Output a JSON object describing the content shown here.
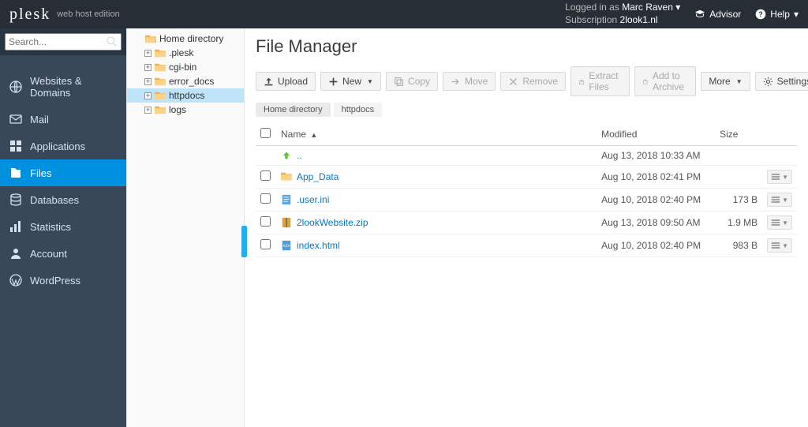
{
  "header": {
    "brand": "plesk",
    "brand_sub": "web host edition",
    "logged_in_label": "Logged in as",
    "user": "Marc Raven",
    "subscription_label": "Subscription",
    "subscription": "2look1.nl",
    "advisor": "Advisor",
    "help": "Help"
  },
  "search": {
    "placeholder": "Search..."
  },
  "nav": {
    "items": [
      {
        "label": "Websites & Domains"
      },
      {
        "label": "Mail"
      },
      {
        "label": "Applications"
      },
      {
        "label": "Files"
      },
      {
        "label": "Databases"
      },
      {
        "label": "Statistics"
      },
      {
        "label": "Account"
      },
      {
        "label": "WordPress"
      }
    ]
  },
  "tree": {
    "root": "Home directory",
    "items": [
      {
        "label": ".plesk"
      },
      {
        "label": "cgi-bin"
      },
      {
        "label": "error_docs"
      },
      {
        "label": "httpdocs"
      },
      {
        "label": "logs"
      }
    ]
  },
  "page": {
    "title": "File Manager"
  },
  "toolbar": {
    "upload": "Upload",
    "new": "New",
    "copy": "Copy",
    "move": "Move",
    "remove": "Remove",
    "extract": "Extract Files",
    "archive": "Add to Archive",
    "more": "More",
    "settings": "Settings"
  },
  "breadcrumb": [
    "Home directory",
    "httpdocs"
  ],
  "columns": {
    "name": "Name",
    "modified": "Modified",
    "size": "Size"
  },
  "files": {
    "up": "..",
    "rows": [
      {
        "type": "folder",
        "name": "App_Data",
        "modified": "Aug 10, 2018 02:41 PM",
        "size": ""
      },
      {
        "type": "ini",
        "name": ".user.ini",
        "modified": "Aug 10, 2018 02:40 PM",
        "size": "173 B"
      },
      {
        "type": "zip",
        "name": "2lookWebsite.zip",
        "modified": "Aug 13, 2018 09:50 AM",
        "size": "1.9 MB"
      },
      {
        "type": "html",
        "name": "index.html",
        "modified": "Aug 10, 2018 02:40 PM",
        "size": "983 B"
      }
    ],
    "up_modified": "Aug 13, 2018 10:33 AM"
  }
}
